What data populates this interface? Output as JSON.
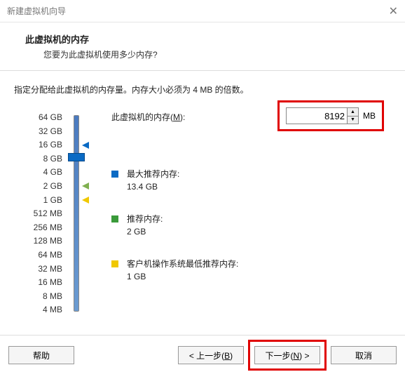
{
  "window": {
    "title": "新建虚拟机向导"
  },
  "header": {
    "title": "此虚拟机的内存",
    "subtitle": "您要为此虚拟机使用多少内存?"
  },
  "instruction": "指定分配给此虚拟机的内存量。内存大小必须为 4 MB 的倍数。",
  "memory": {
    "label_prefix": "此虚拟机的内存(",
    "label_hotkey": "M",
    "label_suffix": "):",
    "value": "8192",
    "unit": "MB"
  },
  "scale": [
    "64 GB",
    "32 GB",
    "16 GB",
    "8 GB",
    "4 GB",
    "2 GB",
    "1 GB",
    "512 MB",
    "256 MB",
    "128 MB",
    "64 MB",
    "32 MB",
    "16 MB",
    "8 MB",
    "4 MB"
  ],
  "recommendations": {
    "max": {
      "label": "最大推荐内存:",
      "value": "13.4 GB"
    },
    "rec": {
      "label": "推荐内存:",
      "value": "2 GB"
    },
    "guest": {
      "label": "客户机操作系统最低推荐内存:",
      "value": "1 GB"
    }
  },
  "buttons": {
    "help": "帮助",
    "back_prefix": "< 上一步(",
    "back_hotkey": "B",
    "back_suffix": ")",
    "next_prefix": "下一步(",
    "next_hotkey": "N",
    "next_suffix": ") >",
    "cancel": "取消"
  }
}
